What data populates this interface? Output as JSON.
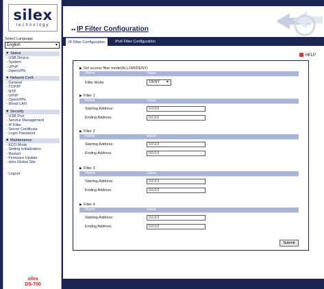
{
  "logo": {
    "brand": "silex",
    "tagline": "technology"
  },
  "sidebar": {
    "language_label": "Select Language",
    "language_value": "English",
    "groups": [
      {
        "head": "▼ Status",
        "items": [
          "- USB Device",
          "- System",
          "- UPnP",
          "- OpenVPN"
        ]
      },
      {
        "head": "▼ Network Conf.",
        "items": [
          "- General",
          "- TCP/IP",
          "- NTP",
          "- UPnP",
          "- OpenVPN",
          "- Wired LAN"
        ]
      },
      {
        "head": "▼ Security",
        "items": [
          "- USB Port",
          "- Service Management",
          "- IP Filter",
          "- Server Certificate",
          "- Login Password"
        ]
      },
      {
        "head": "▼ Maintenance",
        "items": [
          "- ECO Mode",
          "- Setting Initialization",
          "- Restart",
          "- Firmware Update",
          "- silex Global Site"
        ]
      }
    ],
    "logout": "- Logout",
    "product_line1": "silex",
    "product_line2": "DS-700"
  },
  "header": {
    "title": "IP Filter Configuration"
  },
  "tabs": {
    "ipfilter": "IP Filter Configuration",
    "ipv6": "IPv6 Filter Configuration"
  },
  "help": "HELP",
  "mode_section": {
    "title": "Set access filter mode(ALLOW/DENY)",
    "col_name": "Name",
    "col_value": "Value",
    "row_label": "Filter Mode",
    "row_value": "DENY"
  },
  "filters": [
    {
      "title": "Filter 1",
      "col_name": "Name",
      "col_value": "Value",
      "start_label": "Starting Address",
      "start_value": "0.0.0.0",
      "end_label": "Ending Address",
      "end_value": "0.0.0.0"
    },
    {
      "title": "Filter 2",
      "col_name": "Name",
      "col_value": "Value",
      "start_label": "Starting Address",
      "start_value": "0.0.0.0",
      "end_label": "Ending Address",
      "end_value": "0.0.0.0"
    },
    {
      "title": "Filter 3",
      "col_name": "Name",
      "col_value": "Value",
      "start_label": "Starting Address",
      "start_value": "0.0.0.0",
      "end_label": "Ending Address",
      "end_value": "0.0.0.0"
    },
    {
      "title": "Filter 4",
      "col_name": "Name",
      "col_value": "Value",
      "start_label": "Starting Address",
      "start_value": "0.0.0.0",
      "end_label": "Ending Address",
      "end_value": "0.0.0.0"
    }
  ],
  "submit_label": "Submit",
  "colors": {
    "navy": "#1c2452",
    "table_header": "#aab4d4",
    "menu_head": "#d7dcec",
    "product": "#d41818"
  }
}
